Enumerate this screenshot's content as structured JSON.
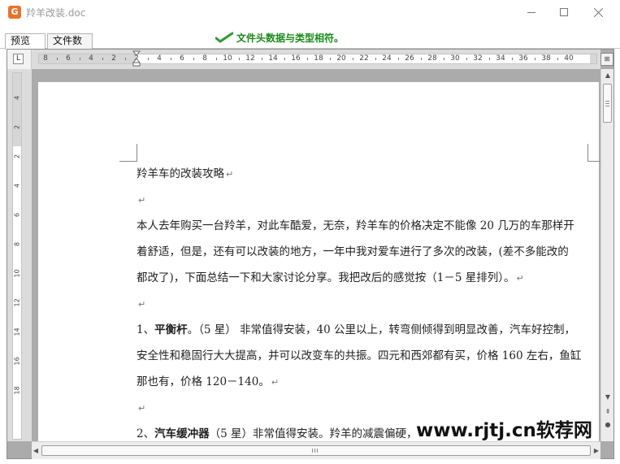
{
  "window": {
    "title": "羚羊改装.doc",
    "app_icon_glyph": "G",
    "icon_color": "#e8742c"
  },
  "tabs": [
    {
      "label": "预览",
      "active": true
    },
    {
      "label": "文件数据",
      "active": false
    }
  ],
  "status": {
    "message": "文件头数据与类型相符。",
    "color": "#1a8a1a",
    "icon": "check-icon"
  },
  "ruler": {
    "horizontal_numbers": [
      "8",
      "6",
      "4",
      "2",
      "2",
      "4",
      "6",
      "8",
      "10",
      "12",
      "14",
      "16",
      "18",
      "20",
      "22",
      "24",
      "26",
      "28",
      "30",
      "32",
      "34",
      "36",
      "38",
      "40"
    ],
    "vertical_numbers": [
      "4",
      "2",
      "2",
      "4",
      "6",
      "8",
      "10",
      "12",
      "14",
      "16",
      "18"
    ],
    "tab_stop_glyph": "L"
  },
  "document": {
    "lines": [
      {
        "text": "羚羊车的改装攻略",
        "mark": "↵"
      },
      {
        "text": "",
        "mark": "↵"
      },
      {
        "text": "本人去年购买一台羚羊，对此车酷爱，无奈，羚羊车的价格决定不能像 20 几万的车那样开",
        "mark": ""
      },
      {
        "text": "着舒适，但是，还有可以改装的地方，一年中我对爱车进行了多次的改装，(差不多能改的",
        "mark": ""
      },
      {
        "text": "都改了)，下面总结一下和大家讨论分享。我把改后的感觉按（1－5 星排列）。",
        "mark": "↵"
      },
      {
        "text": "",
        "mark": "↵"
      },
      {
        "prefix": "1、",
        "bold": "平衡杆",
        "text": "。（5 星） 非常值得安装，40 公里以上，转弯侧倾得到明显改善，汽车好控制，",
        "mark": ""
      },
      {
        "text": "安全性和稳固行大大提高，并可以改变车的共振。四元和西郊都有买，价格 160 左右，鱼缸",
        "mark": ""
      },
      {
        "text": "那也有，价格 120－140。",
        "mark": "↵"
      },
      {
        "text": "",
        "mark": "↵"
      },
      {
        "prefix": "2、",
        "bold": "汽车缓冲器",
        "text": "（5 星）非常值得安装。羚羊的减震偏硬，",
        "mark": ""
      }
    ]
  },
  "watermark": {
    "text": "www.rjtj.cn软荐网"
  }
}
